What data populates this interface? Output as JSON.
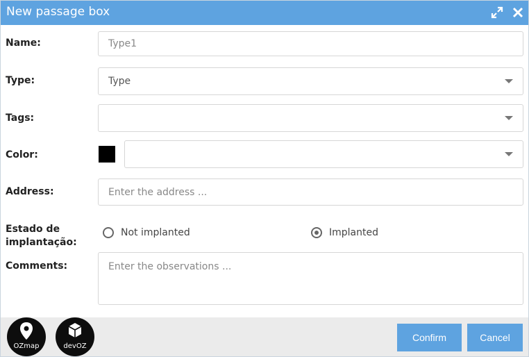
{
  "window": {
    "title": "New passage box"
  },
  "form": {
    "name_label": "Name:",
    "name_value": "Type1",
    "type_label": "Type:",
    "type_value": "Type",
    "tags_label": "Tags:",
    "tags_value": "",
    "color_label": "Color:",
    "color_swatch": "#000000",
    "color_value": "",
    "address_label": "Address:",
    "address_placeholder": "Enter the address ...",
    "status_label_line1": "Estado de",
    "status_label_line2": "implantação:",
    "status_options": [
      {
        "label": "Not implanted",
        "checked": false
      },
      {
        "label": "Implanted",
        "checked": true
      }
    ],
    "comments_label": "Comments:",
    "comments_placeholder": "Enter the observations ..."
  },
  "footer": {
    "logos": [
      {
        "name": "ozmap-logo",
        "text": "OZmap"
      },
      {
        "name": "devoz-logo",
        "text": "devOZ"
      }
    ],
    "confirm_label": "Confirm",
    "cancel_label": "Cancel"
  },
  "colors": {
    "accent": "#5ea3e0",
    "footer_bg": "#ebebeb",
    "logo_bg": "#0d0d0d"
  }
}
